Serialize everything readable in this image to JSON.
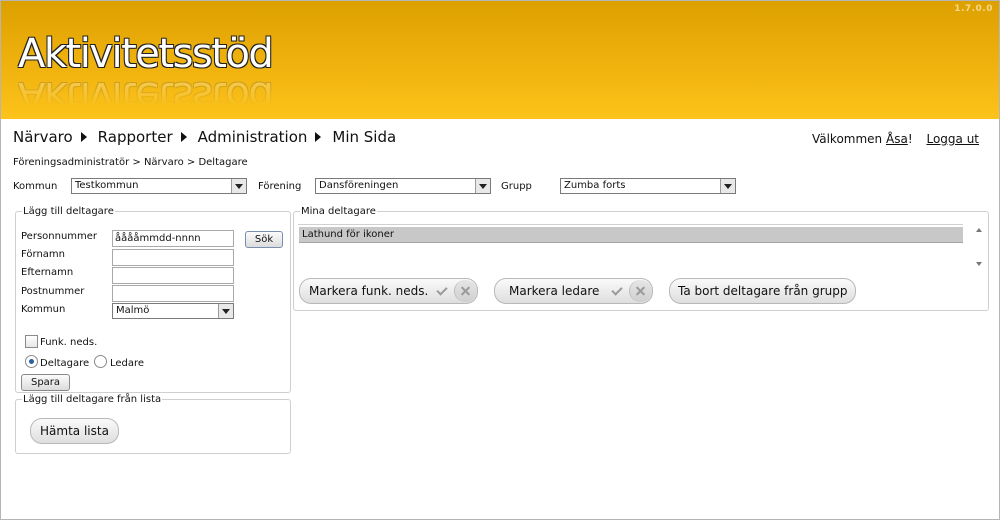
{
  "app": {
    "version": "1.7.0.0",
    "logo_text": "Aktivitetsstöd"
  },
  "nav": {
    "items": [
      {
        "label": "Närvaro"
      },
      {
        "label": "Rapporter"
      },
      {
        "label": "Administration"
      },
      {
        "label": "Min Sida"
      }
    ],
    "welcome_prefix": "Välkommen",
    "user_name": "Åsa",
    "welcome_suffix": "!",
    "logout": "Logga ut"
  },
  "breadcrumb": "Föreningsadministratör > Närvaro > Deltagare",
  "filters": {
    "kommun_label": "Kommun",
    "kommun_value": "Testkommun",
    "forening_label": "Förening",
    "forening_value": "Dansföreningen",
    "grupp_label": "Grupp",
    "grupp_value": "Zumba forts"
  },
  "add_participant": {
    "legend": "Lägg till deltagare",
    "personnummer_label": "Personnummer",
    "personnummer_value": "ååååmmdd-nnnn",
    "search_button": "Sök",
    "fornamn_label": "Förnamn",
    "efternamn_label": "Efternamn",
    "postnummer_label": "Postnummer",
    "kommun_label": "Kommun",
    "kommun_value": "Malmö",
    "funk_neds_label": "Funk. neds.",
    "role_participant": "Deltagare",
    "role_leader": "Ledare",
    "save_button": "Spara"
  },
  "add_from_list": {
    "legend": "Lägg till deltagare från lista",
    "fetch_button": "Hämta lista"
  },
  "my_participants": {
    "legend": "Mina deltagare",
    "rows": [
      "Lathund för ikoner"
    ],
    "mark_funk_button": "Markera funk. neds.",
    "mark_leader_button": "Markera ledare",
    "remove_button": "Ta bort deltagare från grupp"
  }
}
